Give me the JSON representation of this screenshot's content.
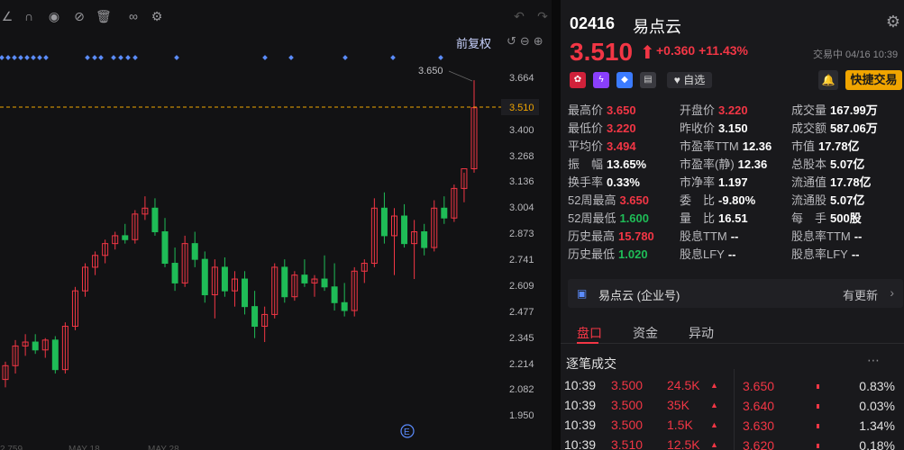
{
  "toolbar": {
    "icons": [
      "draw-line-icon",
      "magnet-icon",
      "eye-icon",
      "eye-off-icon",
      "trash-icon",
      "link-icon",
      "settings-icon"
    ],
    "undo_icon": "undo-icon",
    "redo_icon": "redo-icon"
  },
  "chart": {
    "adjust_label": "前复权",
    "peak_label": "3.650",
    "current_price_label": "3.510",
    "event_marker": "E",
    "y_ticks": [
      "3.664",
      "3.510",
      "3.400",
      "3.268",
      "3.136",
      "3.004",
      "2.873",
      "2.741",
      "2.609",
      "2.477",
      "2.345",
      "2.214",
      "2.082",
      "1.950"
    ],
    "x_labels": [
      "2.759",
      "MAY 18",
      "MAY 28"
    ]
  },
  "chart_data": {
    "type": "candlestick",
    "ylim": [
      1.9,
      3.75
    ],
    "candles": [
      {
        "o": 2.13,
        "h": 2.22,
        "l": 2.09,
        "c": 2.2
      },
      {
        "o": 2.2,
        "h": 2.33,
        "l": 2.16,
        "c": 2.3
      },
      {
        "o": 2.3,
        "h": 2.36,
        "l": 2.25,
        "c": 2.32
      },
      {
        "o": 2.32,
        "h": 2.36,
        "l": 2.26,
        "c": 2.28
      },
      {
        "o": 2.28,
        "h": 2.34,
        "l": 2.24,
        "c": 2.33
      },
      {
        "o": 2.33,
        "h": 2.35,
        "l": 2.16,
        "c": 2.18
      },
      {
        "o": 2.18,
        "h": 2.42,
        "l": 2.16,
        "c": 2.4
      },
      {
        "o": 2.4,
        "h": 2.6,
        "l": 2.38,
        "c": 2.58
      },
      {
        "o": 2.58,
        "h": 2.72,
        "l": 2.55,
        "c": 2.7
      },
      {
        "o": 2.7,
        "h": 2.78,
        "l": 2.66,
        "c": 2.76
      },
      {
        "o": 2.76,
        "h": 2.84,
        "l": 2.72,
        "c": 2.82
      },
      {
        "o": 2.82,
        "h": 2.88,
        "l": 2.79,
        "c": 2.86
      },
      {
        "o": 2.86,
        "h": 2.92,
        "l": 2.82,
        "c": 2.84
      },
      {
        "o": 2.84,
        "h": 2.99,
        "l": 2.82,
        "c": 2.97
      },
      {
        "o": 2.97,
        "h": 3.06,
        "l": 2.94,
        "c": 3.0
      },
      {
        "o": 3.0,
        "h": 3.05,
        "l": 2.86,
        "c": 2.88
      },
      {
        "o": 2.88,
        "h": 2.95,
        "l": 2.7,
        "c": 2.72
      },
      {
        "o": 2.72,
        "h": 2.8,
        "l": 2.58,
        "c": 2.62
      },
      {
        "o": 2.62,
        "h": 2.86,
        "l": 2.6,
        "c": 2.82
      },
      {
        "o": 2.82,
        "h": 2.88,
        "l": 2.7,
        "c": 2.74
      },
      {
        "o": 2.74,
        "h": 2.78,
        "l": 2.52,
        "c": 2.56
      },
      {
        "o": 2.56,
        "h": 2.74,
        "l": 2.44,
        "c": 2.7
      },
      {
        "o": 2.7,
        "h": 2.75,
        "l": 2.55,
        "c": 2.58
      },
      {
        "o": 2.58,
        "h": 2.68,
        "l": 2.5,
        "c": 2.64
      },
      {
        "o": 2.64,
        "h": 2.68,
        "l": 2.46,
        "c": 2.5
      },
      {
        "o": 2.5,
        "h": 2.58,
        "l": 2.34,
        "c": 2.4
      },
      {
        "o": 2.4,
        "h": 2.5,
        "l": 2.32,
        "c": 2.46
      },
      {
        "o": 2.46,
        "h": 2.72,
        "l": 2.44,
        "c": 2.7
      },
      {
        "o": 2.7,
        "h": 2.74,
        "l": 2.52,
        "c": 2.55
      },
      {
        "o": 2.55,
        "h": 2.68,
        "l": 2.53,
        "c": 2.66
      },
      {
        "o": 2.66,
        "h": 2.74,
        "l": 2.6,
        "c": 2.62
      },
      {
        "o": 2.62,
        "h": 2.66,
        "l": 2.55,
        "c": 2.64
      },
      {
        "o": 2.64,
        "h": 2.76,
        "l": 2.58,
        "c": 2.6
      },
      {
        "o": 2.6,
        "h": 2.72,
        "l": 2.48,
        "c": 2.52
      },
      {
        "o": 2.52,
        "h": 2.62,
        "l": 2.45,
        "c": 2.48
      },
      {
        "o": 2.48,
        "h": 2.7,
        "l": 2.45,
        "c": 2.68
      },
      {
        "o": 2.68,
        "h": 2.74,
        "l": 2.62,
        "c": 2.72
      },
      {
        "o": 2.72,
        "h": 3.05,
        "l": 2.7,
        "c": 3.0
      },
      {
        "o": 3.0,
        "h": 3.08,
        "l": 2.82,
        "c": 2.86
      },
      {
        "o": 2.86,
        "h": 3.0,
        "l": 2.66,
        "c": 2.96
      },
      {
        "o": 2.96,
        "h": 3.02,
        "l": 2.8,
        "c": 2.82
      },
      {
        "o": 2.82,
        "h": 2.94,
        "l": 2.64,
        "c": 2.88
      },
      {
        "o": 2.88,
        "h": 2.92,
        "l": 2.76,
        "c": 2.8
      },
      {
        "o": 2.8,
        "h": 3.04,
        "l": 2.78,
        "c": 3.0
      },
      {
        "o": 3.0,
        "h": 3.06,
        "l": 2.92,
        "c": 2.95
      },
      {
        "o": 2.95,
        "h": 3.12,
        "l": 2.93,
        "c": 3.1
      },
      {
        "o": 3.1,
        "h": 3.18,
        "l": 3.03,
        "c": 3.2
      },
      {
        "o": 3.2,
        "h": 3.65,
        "l": 3.18,
        "c": 3.51
      }
    ]
  },
  "header": {
    "code": "02416",
    "name": "易点云",
    "price": "3.510",
    "arrow": "⬆",
    "change": "+0.360",
    "change_pct": "+11.43%",
    "status": "交易中 04/16 10:39"
  },
  "actions": {
    "watch_label": "自选",
    "quick_trade_label": "快捷交易"
  },
  "stats": [
    {
      "k": "最高价",
      "v": "3.650",
      "c": "red"
    },
    {
      "k": "开盘价",
      "v": "3.220",
      "c": "red"
    },
    {
      "k": "成交量",
      "v": "167.99万",
      "c": "white"
    },
    {
      "k": "最低价",
      "v": "3.220",
      "c": "red"
    },
    {
      "k": "昨收价",
      "v": "3.150",
      "c": "white"
    },
    {
      "k": "成交额",
      "v": "587.06万",
      "c": "white"
    },
    {
      "k": "平均价",
      "v": "3.494",
      "c": "red"
    },
    {
      "k": "市盈率TTM",
      "v": "12.36",
      "c": "white"
    },
    {
      "k": "市值",
      "v": "17.78亿",
      "c": "white"
    },
    {
      "k": "振　幅",
      "v": "13.65%",
      "c": "white"
    },
    {
      "k": "市盈率(静)",
      "v": "12.36",
      "c": "white"
    },
    {
      "k": "总股本",
      "v": "5.07亿",
      "c": "white"
    },
    {
      "k": "换手率",
      "v": "0.33%",
      "c": "white"
    },
    {
      "k": "市净率",
      "v": "1.197",
      "c": "white"
    },
    {
      "k": "流通值",
      "v": "17.78亿",
      "c": "white"
    },
    {
      "k": "52周最高",
      "v": "3.650",
      "c": "red"
    },
    {
      "k": "委　比",
      "v": "-9.80%",
      "c": "white"
    },
    {
      "k": "流通股",
      "v": "5.07亿",
      "c": "white"
    },
    {
      "k": "52周最低",
      "v": "1.600",
      "c": "green"
    },
    {
      "k": "量　比",
      "v": "16.51",
      "c": "white"
    },
    {
      "k": "每　手",
      "v": "500股",
      "c": "white"
    },
    {
      "k": "历史最高",
      "v": "15.780",
      "c": "red"
    },
    {
      "k": "股息TTM",
      "v": "--",
      "c": "white"
    },
    {
      "k": "股息率TTM",
      "v": "--",
      "c": "white"
    },
    {
      "k": "历史最低",
      "v": "1.020",
      "c": "green"
    },
    {
      "k": "股息LFY",
      "v": "--",
      "c": "white"
    },
    {
      "k": "股息率LFY",
      "v": "--",
      "c": "white"
    }
  ],
  "enterprise": {
    "label": "易点云 (企业号)",
    "update": "有更新"
  },
  "tabs": [
    "盘口",
    "资金",
    "异动"
  ],
  "ticks": {
    "title": "逐笔成交",
    "rows": [
      {
        "t": "10:39",
        "p": "3.500",
        "v": "24.5K"
      },
      {
        "t": "10:39",
        "p": "3.500",
        "v": "35K"
      },
      {
        "t": "10:39",
        "p": "3.500",
        "v": "1.5K"
      },
      {
        "t": "10:39",
        "p": "3.510",
        "v": "12.5K"
      }
    ]
  },
  "orderbook": [
    {
      "p": "3.650",
      "pct": "0.83%"
    },
    {
      "p": "3.640",
      "pct": "0.03%"
    },
    {
      "p": "3.630",
      "pct": "1.34%"
    },
    {
      "p": "3.620",
      "pct": "0.18%"
    }
  ]
}
